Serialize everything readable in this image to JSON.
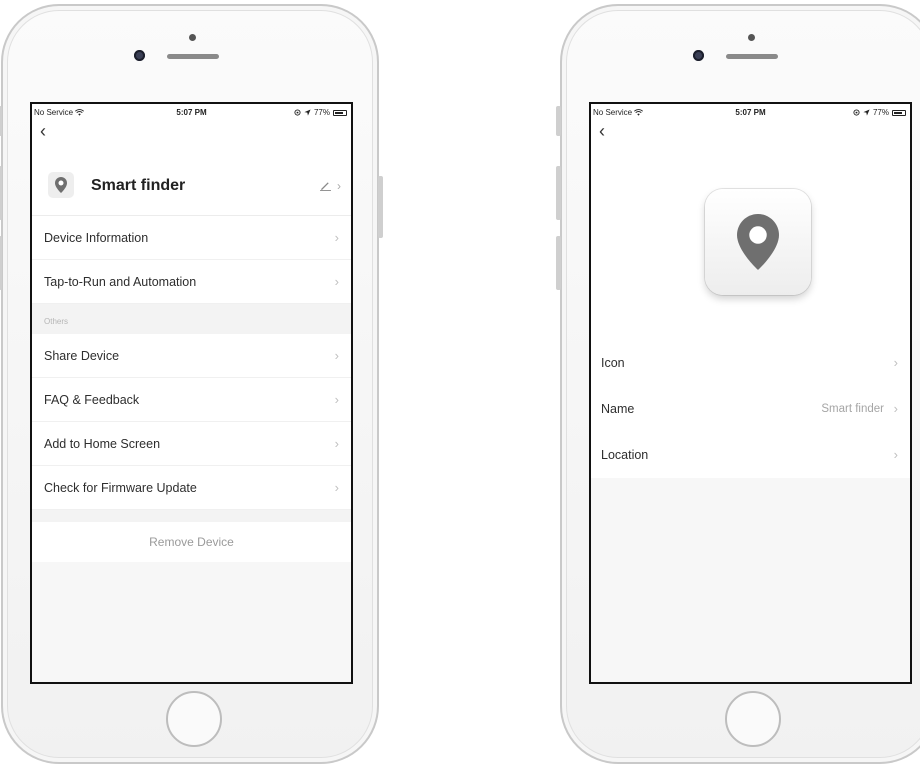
{
  "statusbar": {
    "carrier": "No Service",
    "time": "5:07 PM",
    "battery": "77%",
    "battery_level": 0.77
  },
  "icons": {
    "back": "back-chevron-icon",
    "wifi": "wifi-icon",
    "location": "location-arrow-icon",
    "lock": "rotation-lock-icon",
    "battery": "battery-icon",
    "pin": "map-pin-icon",
    "edit": "pencil-icon",
    "chevron": "chevron-right-icon"
  },
  "colors": {
    "pin": "#6f6f6f",
    "separator_bg": "#f3f3f3",
    "secondary_text": "#a5a5a5"
  },
  "left_screen": {
    "device_name": "Smart finder",
    "rows_top": [
      {
        "label": "Device Information"
      },
      {
        "label": "Tap-to-Run and Automation"
      }
    ],
    "section_label": "Others",
    "rows_others": [
      {
        "label": "Share Device"
      },
      {
        "label": "FAQ & Feedback"
      },
      {
        "label": "Add to Home Screen"
      },
      {
        "label": "Check for Firmware Update"
      }
    ],
    "remove_label": "Remove Device"
  },
  "right_screen": {
    "rows": [
      {
        "label": "Icon",
        "value": ""
      },
      {
        "label": "Name",
        "value": "Smart finder"
      },
      {
        "label": "Location",
        "value": ""
      }
    ]
  },
  "glyphs": {
    "back": "‹",
    "chevron": "›"
  }
}
